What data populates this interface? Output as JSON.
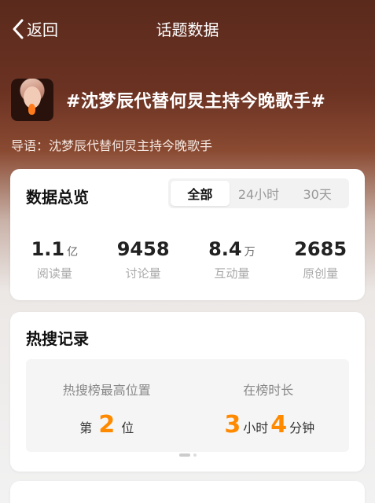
{
  "nav": {
    "back_label": "返回",
    "title": "话题数据"
  },
  "topic": {
    "title": "#沈梦辰代替何炅主持今晚歌手#",
    "intro": "导语：沈梦辰代替何炅主持今晚歌手"
  },
  "overview": {
    "title": "数据总览",
    "tabs": [
      "全部",
      "24小时",
      "30天"
    ],
    "active_tab": "全部",
    "stats": [
      {
        "value": "1.1",
        "unit": "亿",
        "label": "阅读量"
      },
      {
        "value": "9458",
        "unit": "",
        "label": "讨论量"
      },
      {
        "value": "8.4",
        "unit": "万",
        "label": "互动量"
      },
      {
        "value": "2685",
        "unit": "",
        "label": "原创量"
      }
    ]
  },
  "hot": {
    "title": "热搜记录",
    "rank_label": "热搜榜最高位置",
    "rank_prefix": "第",
    "rank_value": "2",
    "rank_suffix": "位",
    "duration_label": "在榜时长",
    "hours_value": "3",
    "hours_unit": "小时",
    "minutes_value": "4",
    "minutes_unit": "分钟"
  },
  "colors": {
    "accent": "#ff8a00"
  }
}
